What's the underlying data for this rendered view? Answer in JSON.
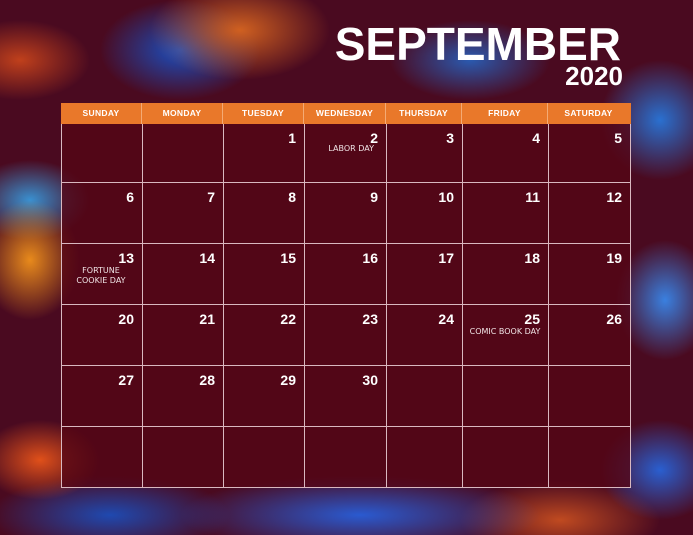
{
  "header": {
    "month": "SEPTEMBER",
    "year": "2020"
  },
  "weekdays": [
    "SUNDAY",
    "MONDAY",
    "TUESDAY",
    "WEDNESDAY",
    "THURSDAY",
    "FRIDAY",
    "SATURDAY"
  ],
  "cells": [
    {
      "day": "",
      "note": ""
    },
    {
      "day": "",
      "note": ""
    },
    {
      "day": "1",
      "note": ""
    },
    {
      "day": "2",
      "note": "LABOR DAY"
    },
    {
      "day": "3",
      "note": ""
    },
    {
      "day": "4",
      "note": ""
    },
    {
      "day": "5",
      "note": ""
    },
    {
      "day": "6",
      "note": ""
    },
    {
      "day": "7",
      "note": ""
    },
    {
      "day": "8",
      "note": ""
    },
    {
      "day": "9",
      "note": ""
    },
    {
      "day": "10",
      "note": ""
    },
    {
      "day": "11",
      "note": ""
    },
    {
      "day": "12",
      "note": ""
    },
    {
      "day": "13",
      "note": "FORTUNE COOKIE DAY"
    },
    {
      "day": "14",
      "note": ""
    },
    {
      "day": "15",
      "note": ""
    },
    {
      "day": "16",
      "note": ""
    },
    {
      "day": "17",
      "note": ""
    },
    {
      "day": "18",
      "note": ""
    },
    {
      "day": "19",
      "note": ""
    },
    {
      "day": "20",
      "note": ""
    },
    {
      "day": "21",
      "note": ""
    },
    {
      "day": "22",
      "note": ""
    },
    {
      "day": "23",
      "note": ""
    },
    {
      "day": "24",
      "note": ""
    },
    {
      "day": "25",
      "note": "COMIC BOOK DAY"
    },
    {
      "day": "26",
      "note": ""
    },
    {
      "day": "27",
      "note": ""
    },
    {
      "day": "28",
      "note": ""
    },
    {
      "day": "29",
      "note": ""
    },
    {
      "day": "30",
      "note": ""
    },
    {
      "day": "",
      "note": ""
    },
    {
      "day": "",
      "note": ""
    },
    {
      "day": "",
      "note": ""
    },
    {
      "day": "",
      "note": ""
    },
    {
      "day": "",
      "note": ""
    },
    {
      "day": "",
      "note": ""
    },
    {
      "day": "",
      "note": ""
    },
    {
      "day": "",
      "note": ""
    },
    {
      "day": "",
      "note": ""
    },
    {
      "day": "",
      "note": ""
    }
  ]
}
